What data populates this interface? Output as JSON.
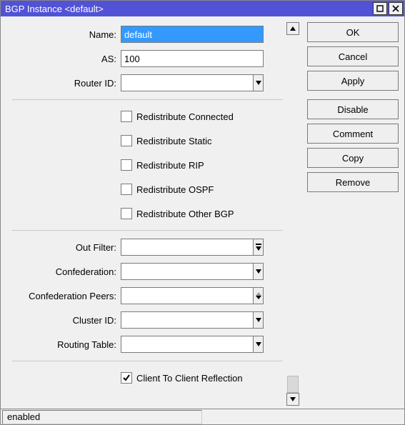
{
  "window": {
    "title": "BGP Instance <default>"
  },
  "labels": {
    "name": "Name:",
    "as": "AS:",
    "router_id": "Router ID:",
    "out_filter": "Out Filter:",
    "confederation": "Confederation:",
    "confederation_peers": "Confederation Peers:",
    "cluster_id": "Cluster ID:",
    "routing_table": "Routing Table:"
  },
  "values": {
    "name": "default",
    "as": "100",
    "router_id": "",
    "out_filter": "",
    "confederation": "",
    "confederation_peers": "",
    "cluster_id": "",
    "routing_table": ""
  },
  "checkboxes": {
    "redistribute_connected": {
      "label": "Redistribute Connected",
      "checked": false
    },
    "redistribute_static": {
      "label": "Redistribute Static",
      "checked": false
    },
    "redistribute_rip": {
      "label": "Redistribute RIP",
      "checked": false
    },
    "redistribute_ospf": {
      "label": "Redistribute OSPF",
      "checked": false
    },
    "redistribute_other_bgp": {
      "label": "Redistribute Other BGP",
      "checked": false
    },
    "client_to_client": {
      "label": "Client To Client Reflection",
      "checked": true
    }
  },
  "buttons": {
    "ok": "OK",
    "cancel": "Cancel",
    "apply": "Apply",
    "disable": "Disable",
    "comment": "Comment",
    "copy": "Copy",
    "remove": "Remove"
  },
  "status": "enabled"
}
